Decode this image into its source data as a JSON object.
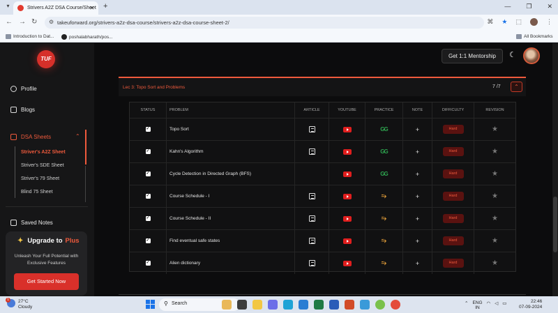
{
  "browser": {
    "tab_title": "Strivers A2Z DSA Course/Sheet",
    "url": "takeuforward.org/strivers-a2z-dsa-course/strivers-a2z-dsa-course-sheet-2/",
    "bookmarks": [
      "Introduction to Dat...",
      "poshalabharath/pos..."
    ],
    "all_bookmarks": "All Bookmarks"
  },
  "header": {
    "logo": "TUF",
    "mentorship_label": "Get 1:1 Mentorship"
  },
  "sidebar": {
    "profile": "Profile",
    "blogs": "Blogs",
    "dsa_sheets": "DSA Sheets",
    "sheets": [
      "Striver's A2Z Sheet",
      "Striver's SDE Sheet",
      "Striver's 79 Sheet",
      "Blind 75 Sheet"
    ],
    "saved_notes": "Saved Notes",
    "upgrade": {
      "title_prefix": "Upgrade to",
      "title_accent": "Plus",
      "description": "Unleash Your Full Potential with Exclusive Features",
      "button": "Get Started Now"
    }
  },
  "lecture": {
    "title": "Lec 3: Topo Sort and Problems",
    "progress": "7 /7"
  },
  "table": {
    "headers": [
      "STATUS",
      "PROBLEM",
      "ARTICLE",
      "YOUTUBE",
      "PRACTICE",
      "NOTE",
      "DIFFICULTY",
      "REVISION"
    ],
    "rows": [
      {
        "problem": "Topo Sort",
        "article": true,
        "practice": "gfg",
        "difficulty": "Hard"
      },
      {
        "problem": "Kahn's Algorithm",
        "article": true,
        "practice": "gfg",
        "difficulty": "Hard"
      },
      {
        "problem": "Cycle Detection in Directed Graph (BFS)",
        "article": false,
        "practice": "gfg",
        "difficulty": "Hard"
      },
      {
        "problem": "Course Schedule - I",
        "article": true,
        "practice": "codingninjas",
        "difficulty": "Hard"
      },
      {
        "problem": "Course Schedule - II",
        "article": true,
        "practice": "codingninjas",
        "difficulty": "Hard"
      },
      {
        "problem": "Find eventual safe states",
        "article": true,
        "practice": "codingninjas",
        "difficulty": "Hard"
      },
      {
        "problem": "Alien dictionary",
        "article": true,
        "practice": "codingninjas",
        "difficulty": "Hard"
      }
    ]
  },
  "taskbar": {
    "temperature": "27°C",
    "weather": "Cloudy",
    "notification_count": "1",
    "search_label": "Search",
    "lang1": "ENG",
    "lang2": "IN",
    "time": "22:46",
    "date": "07-09-2024"
  }
}
